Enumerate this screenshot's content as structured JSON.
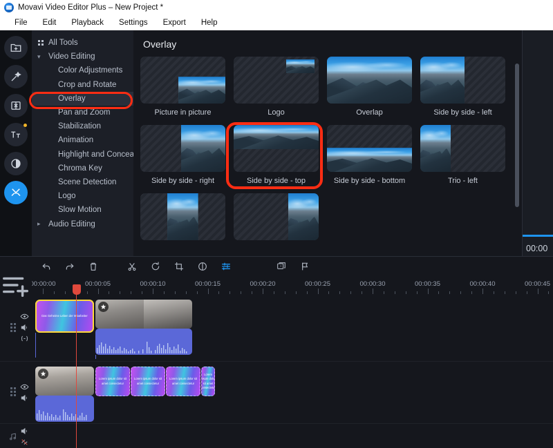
{
  "window": {
    "title": "Movavi Video Editor Plus – New Project *",
    "logo_icon": "movavi-logo-icon"
  },
  "menubar": {
    "items": [
      {
        "label": "File"
      },
      {
        "label": "Edit"
      },
      {
        "label": "Playback"
      },
      {
        "label": "Settings"
      },
      {
        "label": "Export"
      },
      {
        "label": "Help"
      }
    ]
  },
  "rail": {
    "buttons": [
      {
        "name": "import-media",
        "icon": "folder-plus-icon",
        "active": false,
        "badge": false
      },
      {
        "name": "filters",
        "icon": "magic-wand-icon",
        "active": false,
        "badge": false
      },
      {
        "name": "transitions",
        "icon": "transitions-icon",
        "active": false,
        "badge": false
      },
      {
        "name": "titles",
        "icon": "titles-tt-icon",
        "active": false,
        "badge": true
      },
      {
        "name": "stickers",
        "icon": "sticker-icon",
        "active": false,
        "badge": false
      },
      {
        "name": "tools",
        "icon": "tools-wrench-icon",
        "active": true,
        "badge": false
      }
    ]
  },
  "tools_panel": {
    "items": [
      {
        "label": "All Tools",
        "level": 0,
        "marker": "grid",
        "selected": false
      },
      {
        "label": "Video Editing",
        "level": 0,
        "marker": "chevron-down",
        "selected": false
      },
      {
        "label": "Color Adjustments",
        "level": 1,
        "marker": "",
        "selected": false
      },
      {
        "label": "Crop and Rotate",
        "level": 1,
        "marker": "",
        "selected": false
      },
      {
        "label": "Overlay",
        "level": 1,
        "marker": "",
        "selected": true
      },
      {
        "label": "Pan and Zoom",
        "level": 1,
        "marker": "",
        "selected": false
      },
      {
        "label": "Stabilization",
        "level": 1,
        "marker": "",
        "selected": false
      },
      {
        "label": "Animation",
        "level": 1,
        "marker": "",
        "selected": false
      },
      {
        "label": "Highlight and Conceal",
        "level": 1,
        "marker": "",
        "selected": false
      },
      {
        "label": "Chroma Key",
        "level": 1,
        "marker": "",
        "selected": false
      },
      {
        "label": "Scene Detection",
        "level": 1,
        "marker": "",
        "selected": false
      },
      {
        "label": "Logo",
        "level": 1,
        "marker": "",
        "selected": false
      },
      {
        "label": "Slow Motion",
        "level": 1,
        "marker": "",
        "selected": false
      },
      {
        "label": "Audio Editing",
        "level": 0,
        "marker": "chevron-right",
        "selected": false
      }
    ],
    "highlight_target": "Overlay"
  },
  "presets": {
    "title": "Overlay",
    "highlight_target": "Side by side - top",
    "items": [
      {
        "label": "Picture in picture",
        "layout": "pip"
      },
      {
        "label": "Logo",
        "layout": "logo"
      },
      {
        "label": "Overlap",
        "layout": "full"
      },
      {
        "label": "Side by side - left",
        "layout": "left"
      },
      {
        "label": "Side by side - right",
        "layout": "right"
      },
      {
        "label": "Side by side - top",
        "layout": "top"
      },
      {
        "label": "Side by side - bottom",
        "layout": "bottom"
      },
      {
        "label": "Trio - left",
        "layout": "trio-left"
      },
      {
        "label": "",
        "layout": "trio-center"
      },
      {
        "label": "",
        "layout": "trio-right"
      }
    ]
  },
  "preview": {
    "timecode": "00:00"
  },
  "timeline_toolbar": {
    "buttons": [
      {
        "name": "undo-button",
        "icon": "undo-icon",
        "accent": false
      },
      {
        "name": "redo-button",
        "icon": "redo-icon",
        "accent": false
      },
      {
        "name": "delete-button",
        "icon": "trash-icon",
        "accent": false
      },
      {
        "name": "split-button",
        "icon": "scissors-icon",
        "accent": false
      },
      {
        "name": "rotate-button",
        "icon": "rotate-icon",
        "accent": false
      },
      {
        "name": "crop-button",
        "icon": "crop-icon",
        "accent": false
      },
      {
        "name": "color-adjust-button",
        "icon": "color-circle-icon",
        "accent": false
      },
      {
        "name": "properties-button",
        "icon": "sliders-icon",
        "accent": true
      },
      {
        "name": "montage-button",
        "icon": "montage-icon",
        "accent": false
      },
      {
        "name": "marker-button",
        "icon": "flag-icon",
        "accent": false
      }
    ],
    "add_track_icon": "add-track-icon"
  },
  "ruler": {
    "labels": [
      "00:00:00",
      "00:00:05",
      "00:00:10",
      "00:00:15",
      "00:00:20",
      "00:00:25",
      "00:00:30",
      "00:00:35",
      "00:00:40",
      "00:00:45"
    ],
    "playhead_position": "00:00:03"
  },
  "tracks": [
    {
      "name": "overlay-video-track",
      "icons": [
        "eye-icon",
        "speaker-icon",
        "link-icon"
      ],
      "clips": [
        {
          "type": "title",
          "label": "Das Geheime Leben der Mitarbeiter",
          "selected": true
        },
        {
          "type": "video",
          "label": ""
        },
        {
          "type": "audio",
          "label": ""
        }
      ]
    },
    {
      "name": "main-video-track",
      "icons": [
        "eye-icon",
        "speaker-icon"
      ],
      "clips": [
        {
          "type": "video",
          "label": ""
        },
        {
          "type": "audio",
          "label": ""
        },
        {
          "type": "title",
          "label": "Lorem ipsum dolor sit amet consectetur"
        }
      ]
    },
    {
      "name": "audio-track",
      "icons": [
        "speaker-icon",
        "audio-link-off-icon"
      ],
      "header_icon": "music-note-icon",
      "clips": []
    }
  ],
  "colors": {
    "accent": "#1e94ef",
    "highlight": "#ff2d13",
    "selection": "#ffd83b",
    "playhead": "#e0493c",
    "audio_clip": "#5b68d8"
  }
}
